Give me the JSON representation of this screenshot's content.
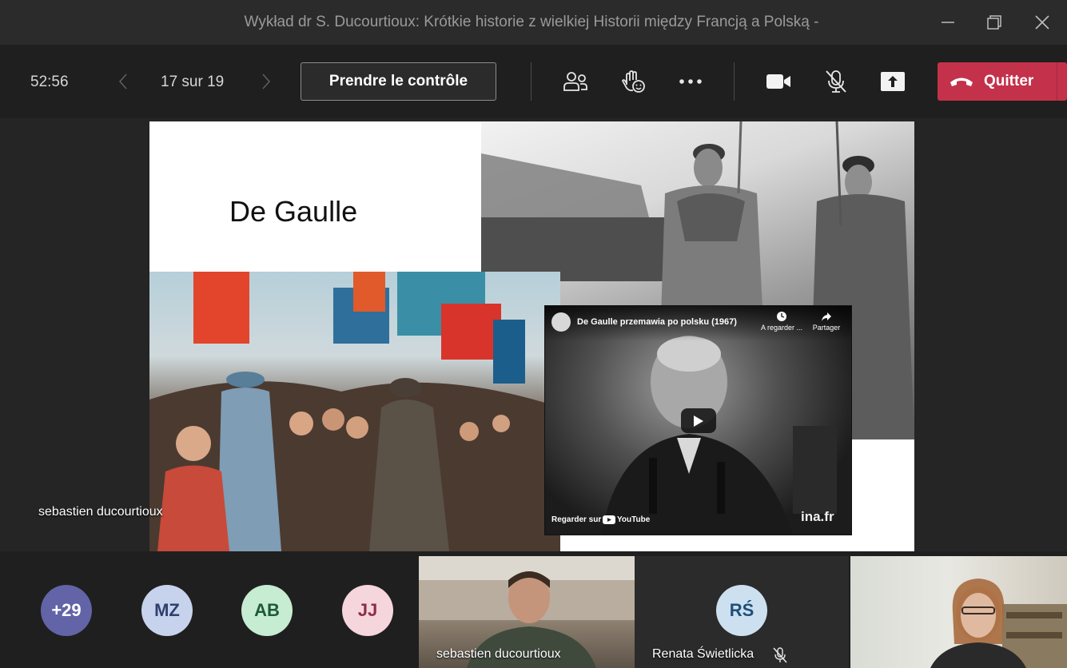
{
  "window": {
    "title": "Wykład dr S. Ducourtioux: Krótkie historie z wielkiej Historii między Francją a Polską -"
  },
  "toolbar": {
    "timer": "52:56",
    "page_counter": "17 sur 19",
    "take_control_label": "Prendre le contrôle",
    "leave_label": "Quitter",
    "leave_color": "#c4314b",
    "icons": [
      "participants-icon",
      "raise-hand-icon",
      "more-options-icon",
      "camera-icon",
      "microphone-muted-icon",
      "share-icon",
      "phone-hangup-icon"
    ]
  },
  "slide": {
    "title": "De Gaulle",
    "video": {
      "title": "De Gaulle przemawia po polsku (1967)",
      "watch_later_label": "A regarder ...",
      "share_label": "Partager",
      "watch_on_label": "Regarder sur",
      "platform_label": "YouTube",
      "watermark": "ina.fr"
    },
    "presenter_label": "sebastien ducourtioux"
  },
  "gallery": {
    "overflow_count": "+29",
    "participants": [
      {
        "initials": "MZ",
        "bg": "#c7d3ec",
        "fg": "#2f3f6e"
      },
      {
        "initials": "AB",
        "bg": "#c6ecd2",
        "fg": "#1d5a35"
      },
      {
        "initials": "JJ",
        "bg": "#f5d6dc",
        "fg": "#8a2f43"
      }
    ],
    "video_tile_name": "sebastien ducourtioux",
    "renata": {
      "initials": "RŚ",
      "bg": "#cde0f0",
      "fg": "#1f4e79",
      "name": "Renata Świetlicka"
    }
  }
}
